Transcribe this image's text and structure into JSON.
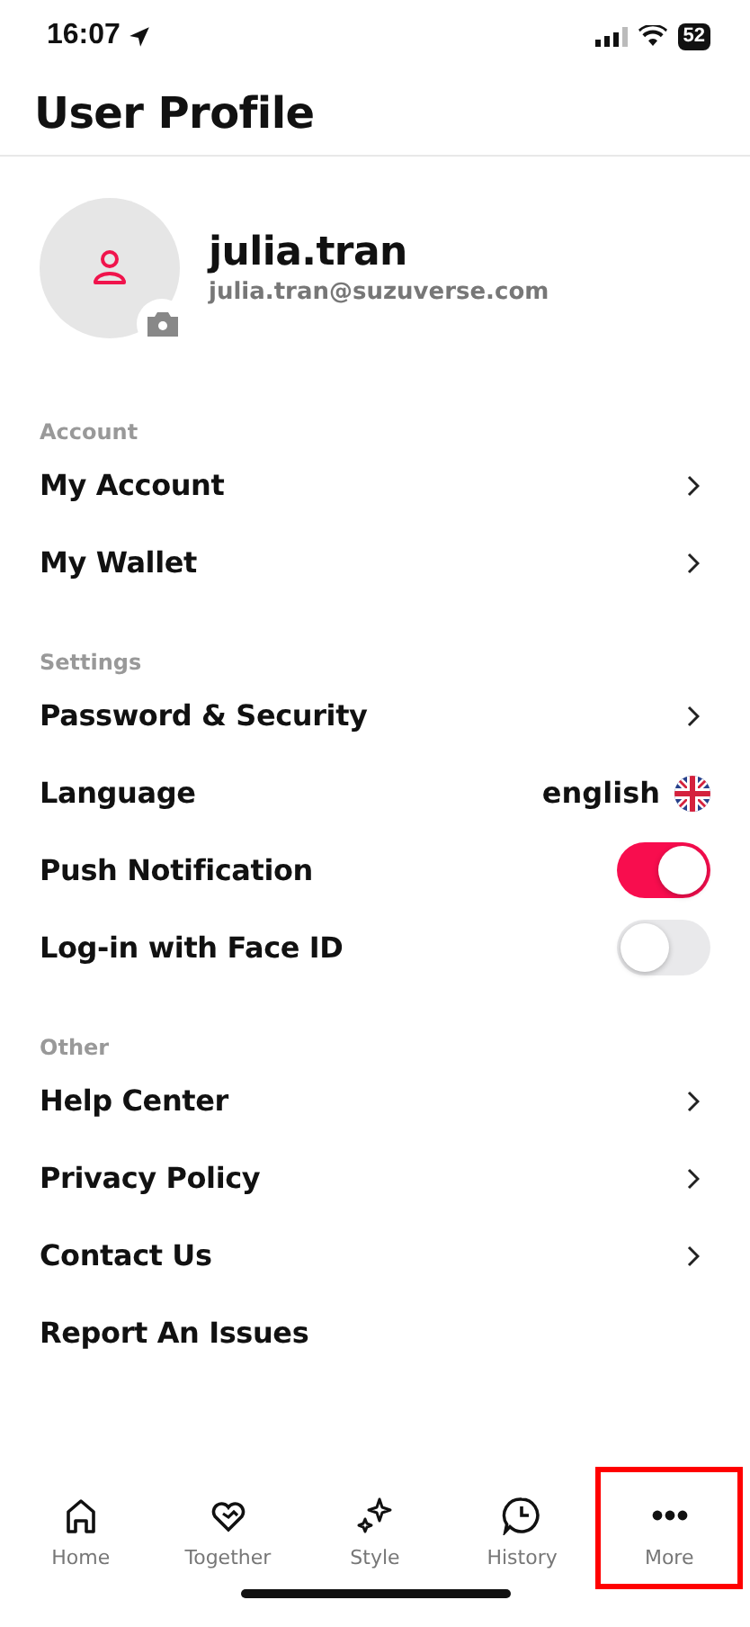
{
  "status_bar": {
    "time": "16:07",
    "battery": "52"
  },
  "header": {
    "title": "User Profile"
  },
  "profile": {
    "username": "julia.tran",
    "email": "julia.tran@suzuverse.com"
  },
  "sections": [
    {
      "title": "Account",
      "rows": [
        {
          "kind": "link",
          "label": "My Account"
        },
        {
          "kind": "link",
          "label": "My Wallet"
        }
      ]
    },
    {
      "title": "Settings",
      "rows": [
        {
          "kind": "link",
          "label": "Password & Security"
        },
        {
          "kind": "value",
          "label": "Language",
          "value": "english"
        },
        {
          "kind": "toggle",
          "label": "Push Notification",
          "on": true
        },
        {
          "kind": "toggle",
          "label": "Log-in with Face ID",
          "on": false
        }
      ]
    },
    {
      "title": "Other",
      "rows": [
        {
          "kind": "link",
          "label": "Help Center"
        },
        {
          "kind": "link",
          "label": "Privacy Policy"
        },
        {
          "kind": "link",
          "label": "Contact Us"
        },
        {
          "kind": "plain",
          "label": "Report An Issues"
        }
      ]
    }
  ],
  "tab_bar": [
    {
      "kind": "home",
      "label": "Home",
      "highlighted": false
    },
    {
      "kind": "heart",
      "label": "Together",
      "highlighted": false
    },
    {
      "kind": "sparkle",
      "label": "Style",
      "highlighted": false
    },
    {
      "kind": "clock",
      "label": "History",
      "highlighted": false
    },
    {
      "kind": "dots",
      "label": "More",
      "highlighted": true
    }
  ]
}
